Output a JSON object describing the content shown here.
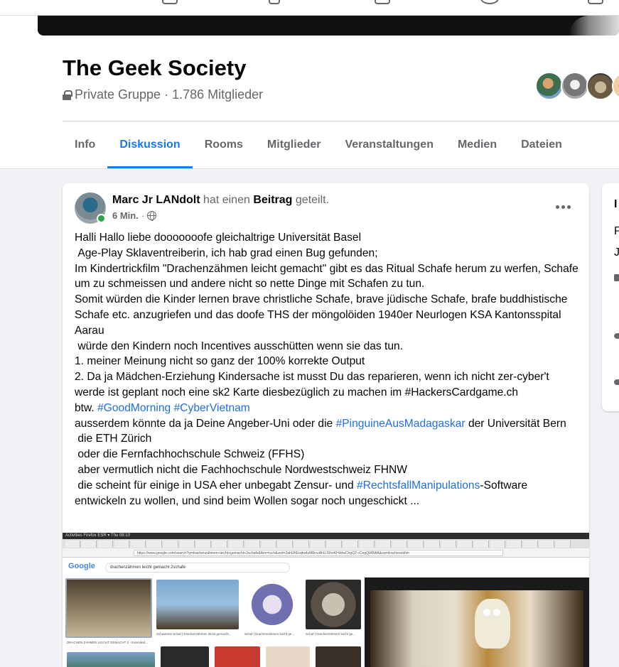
{
  "group": {
    "title": "The Geek Society",
    "privacy": "Private Gruppe",
    "separator": "·",
    "member_count": "1.786 Mitglieder"
  },
  "tabs": [
    {
      "label": "Info"
    },
    {
      "label": "Diskussion",
      "active": true
    },
    {
      "label": "Rooms"
    },
    {
      "label": "Mitglieder"
    },
    {
      "label": "Veranstaltungen"
    },
    {
      "label": "Medien"
    },
    {
      "label": "Dateien"
    }
  ],
  "post": {
    "author": "Marc Jr LANdolt",
    "action_pre": "hat einen",
    "action_obj": "Beitrag",
    "action_post": "geteilt.",
    "time": "6 Min.",
    "time_sep": "·",
    "body": {
      "p1": "Halli Hallo liebe dooooooofe gleichaltrige Universität Basel\n Age-Play Sklaventreiberin, ich hab grad einen Bug gefunden;\nIm Kindertrickfilm \"Drachenzähmen leicht gemacht\" gibt es das Ritual Schafe herum zu werfen, Schafe um zu schmeissen und andere nicht so nette Dinge mit Schafen zu tun.\nSomit würden die Kinder lernen brave christliche Schafe, brave jüdische Schafe, brafe buddhistische Schafe etc. anzugriefen und das doofe THS der möngolöiden 1940er Neurlogen KSA Kantonsspital Aarau\n würde den Kindern noch Incentives ausschütten wenn sie das tun.\n1. meiner Meinung nicht so ganz der 100% korrekte Output\n2. Da ja Mädchen-Erziehung Kindersache ist musst Du das reparieren, wenn ich nicht zer-cyber't werde ist geplant noch eine sk2 Karte diesbezüglich zu machen im #HackersCardgame.ch\nbtw. ",
      "tag1": "#GoodMorning",
      "space1": " ",
      "tag2": "#CyberVietnam",
      "p2": "\nausserdem könnte da ja Deine Angeber-Uni oder die ",
      "tag3": "#PinguineAusMadagaskar",
      "p3": " der Universität Bern\n die ETH Zürich\n oder die Fernfachhochschule Schweiz (FFHS)\n aber vermutlich nicht die Fachhochschule Nordwestschweiz FHNW\n die scheint für einige in USA eher unbegabt Zensur- und ",
      "tag4": "#RechtsfallManipulations",
      "p4": "-Software entwickeln zu wollen, und sind beim Wollen sogar noch ungeschickt ..."
    },
    "screenshot": {
      "topbar": "Activities   Firefox ESR ▾                                                                                                   Thu 08:10",
      "url": "https://www.google.com/search?q=drachenzähmen+leicht+gemacht+2schafe&tbm=isch&ved=2ahUKEwjtw4zM8crvAhUJShoKHddwChgQ2-cCegQIABAA&oq=drachenzähm",
      "google_logo": "Google",
      "query": "drachenzähmen leicht gemacht 2schafe",
      "captions": [
        "DRACHEN ZÄHMEN LEICHT GEMACHT 2 - Extended...",
        "Schwarzes Schaf | Drachenzähmen leicht gemacht...",
        "Schaf | Drachenzähmen leicht ge...",
        "Schaf | Drachenzähmen leicht ge..."
      ]
    }
  },
  "colors": {
    "accent": "#1877f2",
    "hashtag": "#216fdb",
    "secondary_text": "#65676b",
    "online": "#31a24c"
  },
  "icons": [
    "lock-icon",
    "globe-icon",
    "more-icon"
  ]
}
